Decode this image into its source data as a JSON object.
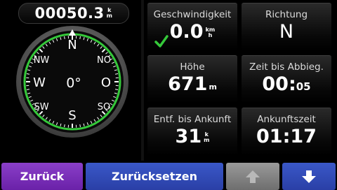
{
  "odometer": {
    "value": "00050.3",
    "unit_top": "k",
    "unit_bottom": "m"
  },
  "compass": {
    "needle_letter": "N",
    "heading": "0°",
    "directions": {
      "n": "N",
      "ne": "NO",
      "e": "O",
      "se": "SO",
      "s": "S",
      "sw": "SW",
      "w": "W",
      "nw": "NW"
    },
    "ring_color": "#35c93a"
  },
  "tiles": {
    "speed": {
      "label": "Geschwindigkeit",
      "value": "0.0",
      "unit_top": "km",
      "unit_bottom": "h",
      "check_icon": "checkmark-icon"
    },
    "direction": {
      "label": "Richtung",
      "value": "N"
    },
    "altitude": {
      "label": "Höhe",
      "value": "671",
      "unit": "m"
    },
    "time_to_turn": {
      "label": "Zeit bis Abbieg.",
      "value": "00:",
      "value_small": "05"
    },
    "distance_to_arrival": {
      "label": "Entf. bis Ankunft",
      "value": "31",
      "unit_top": "k",
      "unit_bottom": "m"
    },
    "arrival_time": {
      "label": "Ankunftszeit",
      "value": "01:17"
    }
  },
  "buttons": {
    "back": "Zurück",
    "reset": "Zurücksetzen",
    "up_icon": "arrow-up-icon",
    "down_icon": "arrow-down-icon"
  },
  "colors": {
    "back": "#7a2fba",
    "reset": "#3049b8",
    "up_disabled": "#8a8a8a",
    "down": "#3049b8"
  }
}
